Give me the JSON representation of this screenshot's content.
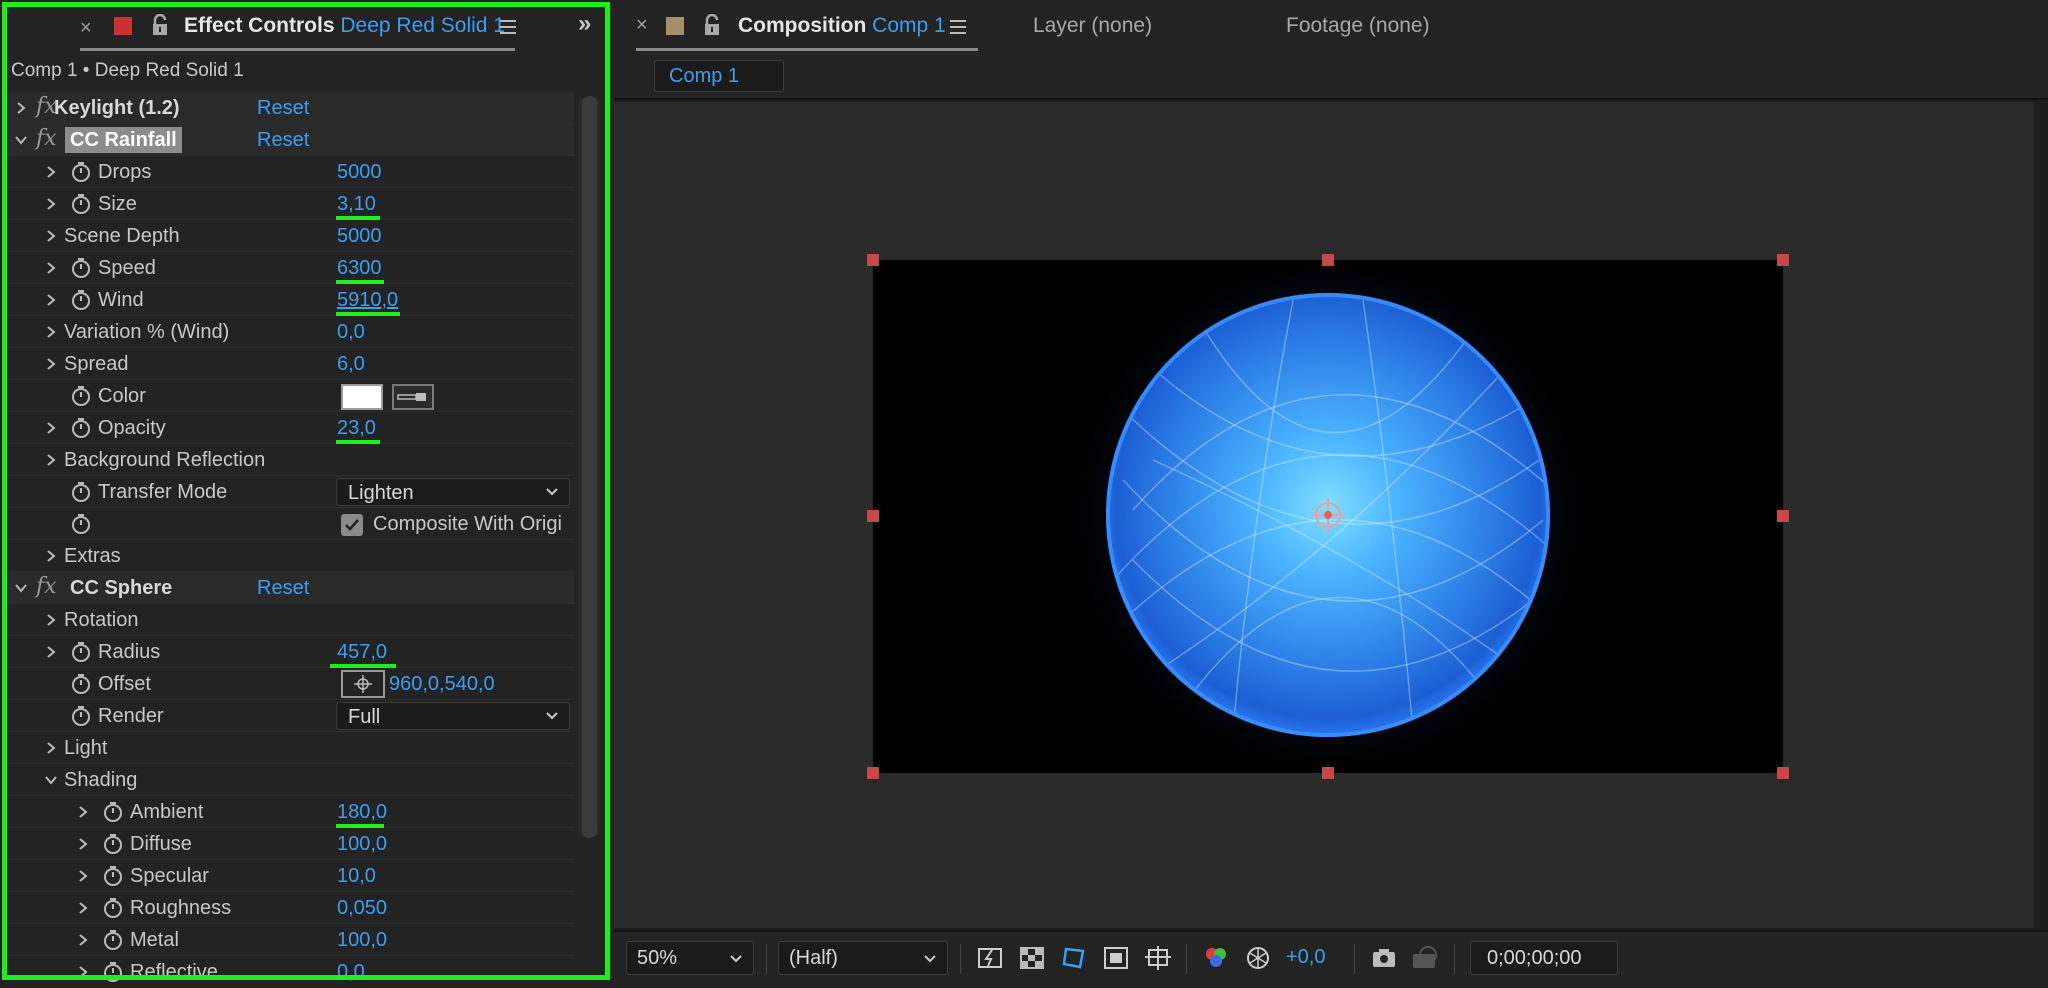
{
  "effect_controls": {
    "close": "×",
    "title_prefix": "Effect Controls",
    "layer_name": "Deep Red Solid 1",
    "more": "»",
    "path": "Comp 1 • Deep Red Solid 1",
    "effects": {
      "keylight": {
        "name": "Keylight (1.2)",
        "reset": "Reset"
      },
      "rainfall": {
        "name": "CC Rainfall",
        "reset": "Reset",
        "drops": {
          "label": "Drops",
          "value": "5000"
        },
        "size": {
          "label": "Size",
          "value": "3,10"
        },
        "scene_depth": {
          "label": "Scene Depth",
          "value": "5000"
        },
        "speed": {
          "label": "Speed",
          "value": "6300"
        },
        "wind": {
          "label": "Wind",
          "value": "5910,0"
        },
        "variation": {
          "label": "Variation % (Wind)",
          "value": "0,0"
        },
        "spread": {
          "label": "Spread",
          "value": "6,0"
        },
        "color": {
          "label": "Color",
          "swatch": "#ffffff"
        },
        "opacity": {
          "label": "Opacity",
          "value": "23,0"
        },
        "bg_reflection": {
          "label": "Background Reflection"
        },
        "transfer_mode": {
          "label": "Transfer Mode",
          "value": "Lighten"
        },
        "composite": {
          "label": "Composite With Origi",
          "checked": true
        },
        "extras": {
          "label": "Extras"
        }
      },
      "sphere": {
        "name": "CC Sphere",
        "reset": "Reset",
        "rotation": {
          "label": "Rotation"
        },
        "radius": {
          "label": "Radius",
          "value": "457,0"
        },
        "offset": {
          "label": "Offset",
          "value": "960,0,540,0"
        },
        "render": {
          "label": "Render",
          "value": "Full"
        },
        "light": {
          "label": "Light"
        },
        "shading": {
          "label": "Shading"
        },
        "ambient": {
          "label": "Ambient",
          "value": "180,0"
        },
        "diffuse": {
          "label": "Diffuse",
          "value": "100,0"
        },
        "specular": {
          "label": "Specular",
          "value": "10,0"
        },
        "roughness": {
          "label": "Roughness",
          "value": "0,050"
        },
        "metal": {
          "label": "Metal",
          "value": "100,0"
        },
        "reflective": {
          "label": "Reflective",
          "value": "0,0"
        }
      }
    }
  },
  "composition": {
    "close": "×",
    "title_prefix": "Composition",
    "comp_name": "Comp 1",
    "layer_tab": "Layer (none)",
    "footage_tab": "Footage (none)",
    "subtab": "Comp 1",
    "zoom": "50%",
    "resolution": "(Half)",
    "exposure": "+0,0",
    "timecode": "0;00;00;00"
  },
  "colors": {
    "accent": "#3b9ef0",
    "highlight_green": "#1bf01b",
    "layer_red": "#c83232",
    "sphere_blue": "#2f86f0"
  }
}
